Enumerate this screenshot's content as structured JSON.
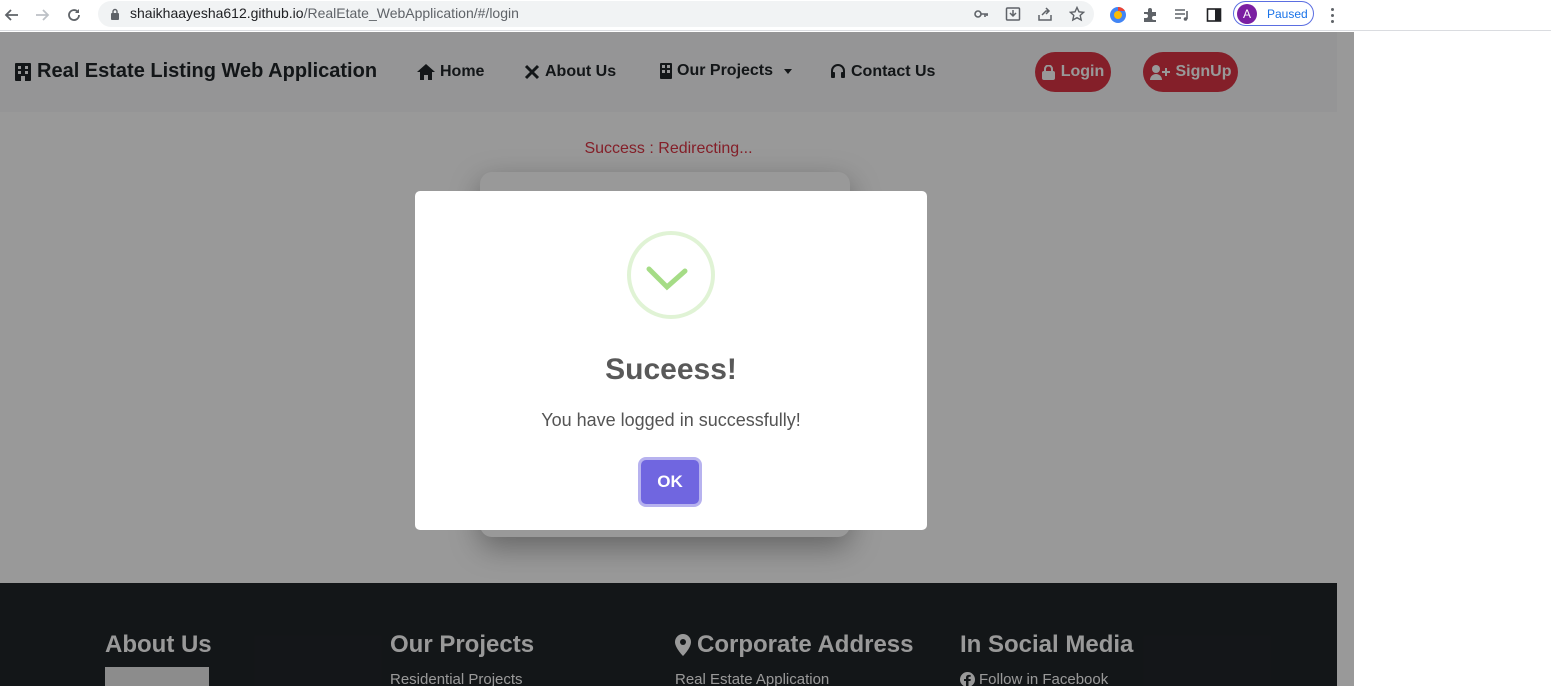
{
  "browser": {
    "url_host": "shaikhaayesha612.github.io",
    "url_path": "/RealEtate_WebApplication/#/login",
    "profile_initial": "A",
    "profile_label": "Paused"
  },
  "navbar": {
    "brand": "Real Estate Listing Web Application",
    "items": [
      {
        "label": "Home"
      },
      {
        "label": "About Us"
      },
      {
        "label": "Our Projects"
      },
      {
        "label": "Contact Us"
      }
    ],
    "login_label": "Login",
    "signup_label": "SignUp"
  },
  "main": {
    "status_text": "Success : Redirecting..."
  },
  "footer": {
    "columns": [
      {
        "heading": "About Us",
        "link": ""
      },
      {
        "heading": "Our Projects",
        "link": "Residential Projects"
      },
      {
        "heading": "Corporate Address",
        "link": "Real Estate Application"
      },
      {
        "heading": "In Social Media",
        "link": "Follow in Facebook"
      }
    ]
  },
  "modal": {
    "title": "Suceess!",
    "text": "You have logged in successfully!",
    "ok_label": "OK"
  },
  "colors": {
    "accent_red": "#dc3545",
    "confirm_purple": "#7066e0",
    "success_green": "#a5dc86"
  }
}
